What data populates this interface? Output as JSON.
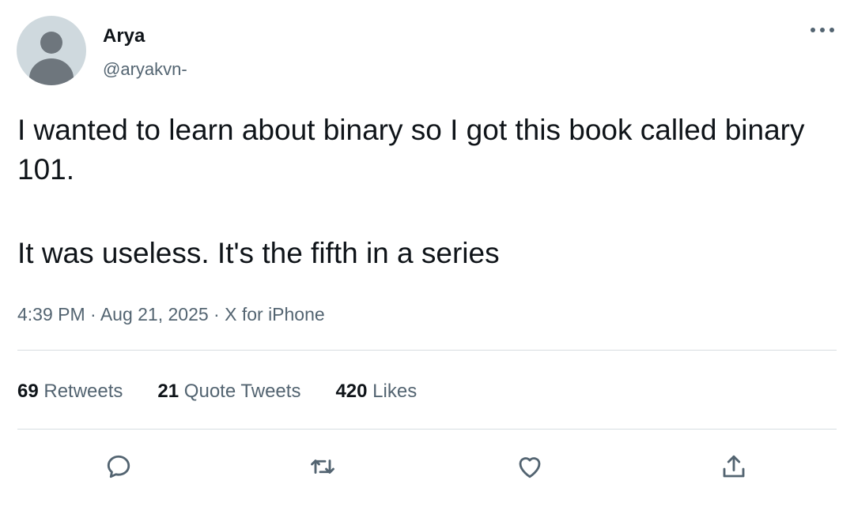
{
  "author": {
    "display_name": "Arya",
    "handle": "@aryakvn-"
  },
  "tweet": {
    "paragraphs": [
      "I wanted to learn about binary so I got this book called binary 101.",
      "It was useless. It's the fifth in a series"
    ],
    "timestamp": "4:39 PM · Aug 21, 2025 · X for iPhone"
  },
  "stats": {
    "retweets": {
      "count": "69",
      "label": "Retweets"
    },
    "quote_tweets": {
      "count": "21",
      "label": "Quote Tweets"
    },
    "likes": {
      "count": "420",
      "label": "Likes"
    }
  },
  "icons": {
    "more": "more-icon",
    "reply": "reply-icon",
    "retweet": "retweet-icon",
    "like": "heart-icon",
    "share": "share-icon"
  },
  "colors": {
    "text_primary": "#0f1419",
    "text_secondary": "#536471",
    "divider": "#d7dde1",
    "avatar_bg": "#cfd9de",
    "avatar_fg": "#6e767d"
  }
}
